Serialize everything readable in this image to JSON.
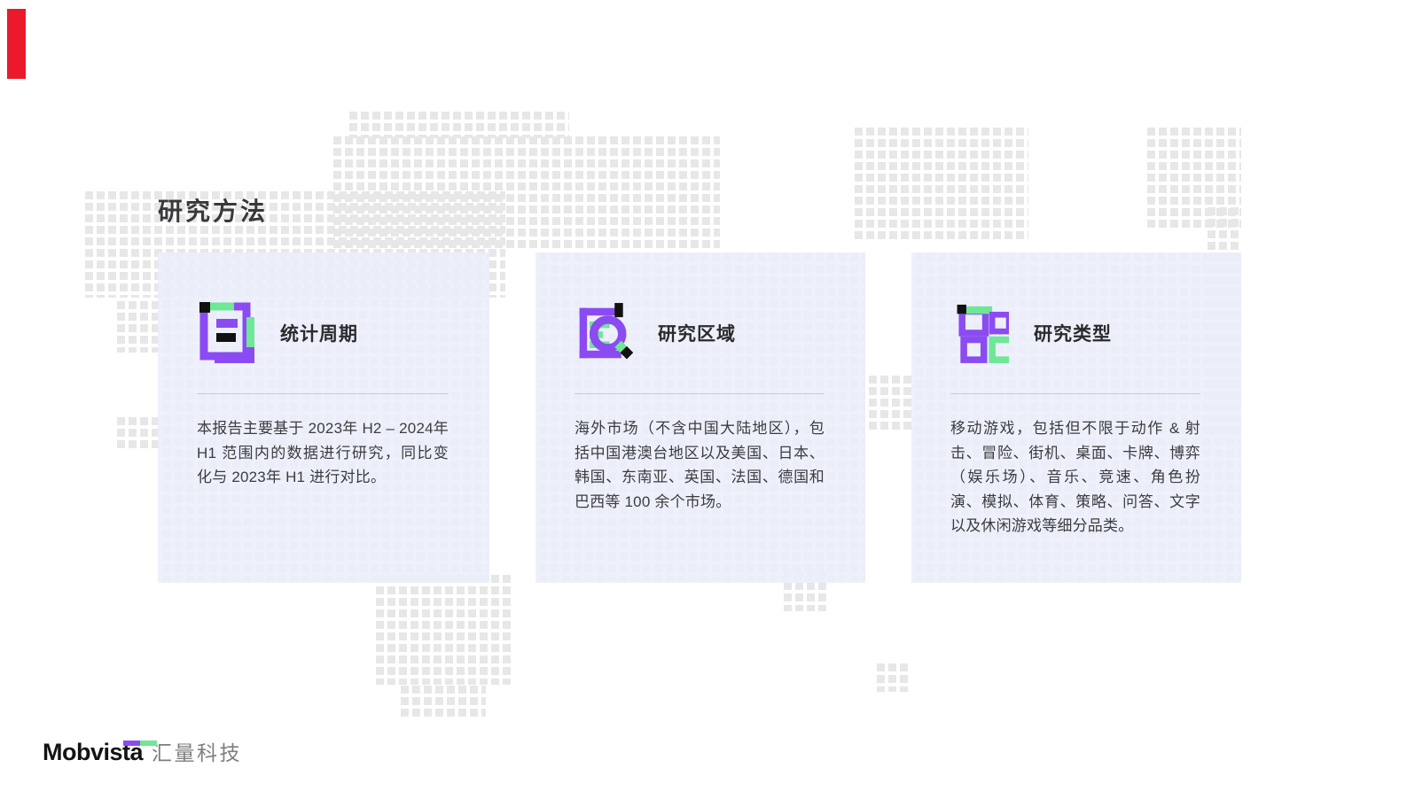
{
  "page_title": "研究方法",
  "accent_colors": {
    "purple": "#8b4bf2",
    "green": "#6ee796",
    "black": "#111111",
    "card_background": "#eef1fb",
    "red_marker": "#ea1a2c"
  },
  "cards": [
    {
      "icon": "report-document-icon",
      "title": "统计周期",
      "body": "本报告主要基于 2023年 H2 – 2024年 H1 范围内的数据进行研究，同比变化与 2023年 H1 进行对比。"
    },
    {
      "icon": "document-magnifier-icon",
      "title": "研究区域",
      "body": "海外市场（不含中国大陆地区），包括中国港澳台地区以及美国、日本、韩国、东南亚、英国、法国、德国和巴西等 100 余个市场。"
    },
    {
      "icon": "category-grid-icon",
      "title": "研究类型",
      "body": "移动游戏，包括但不限于动作 & 射击、冒险、街机、桌面、卡牌、博弈（娱乐场）、音乐、竞速、角色扮演、模拟、体育、策略、问答、文字以及休闲游戏等细分品类。"
    }
  ],
  "footer": {
    "logo_en": "Mobvista",
    "logo_cn": "汇量科技"
  }
}
